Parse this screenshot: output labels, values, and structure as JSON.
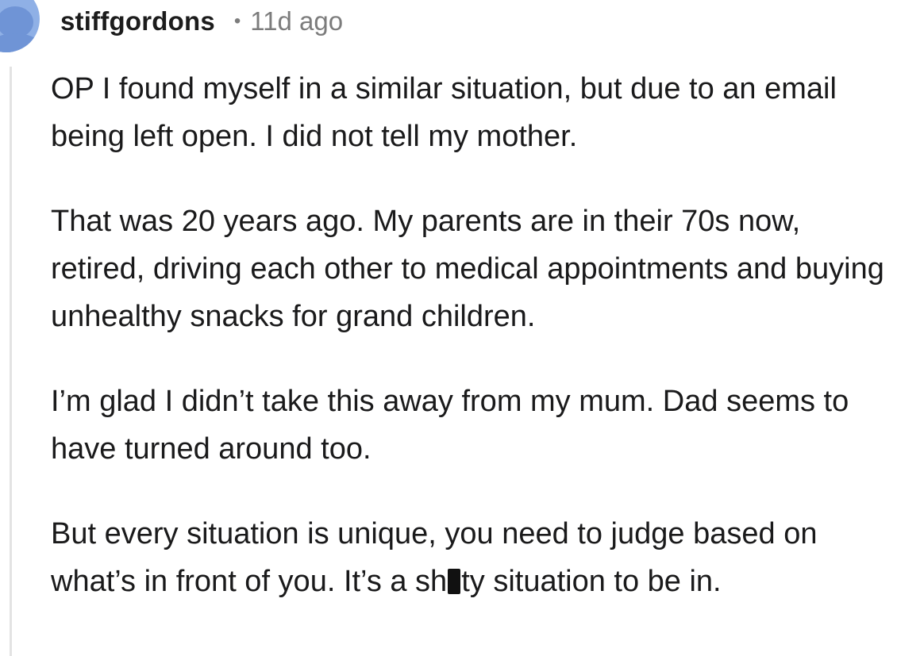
{
  "comment": {
    "username": "stiffgordons",
    "separator": "•",
    "timestamp": "11d ago",
    "paragraphs": [
      "OP I found myself in a similar situation, but due to an email being left open. I did not tell my mother.",
      "That was 20 years ago. My parents are in their 70s now, retired, driving each other to medical appointments and buying unhealthy snacks for grand children.",
      "I’m glad I didn’t take this away from my mum. Dad seems to have turned around too."
    ],
    "last_paragraph": {
      "before_redaction": "But every situation is unique, you need to judge based on what’s in front of you. It’s a sh",
      "after_redaction": "ty situation to be in."
    }
  },
  "icons": {
    "avatar": "reddit-snoo-avatar-icon"
  },
  "colors": {
    "avatar_background": "#8fb0e6",
    "meta_text": "#7c7c7c",
    "thread_line": "#e3e3e3"
  }
}
